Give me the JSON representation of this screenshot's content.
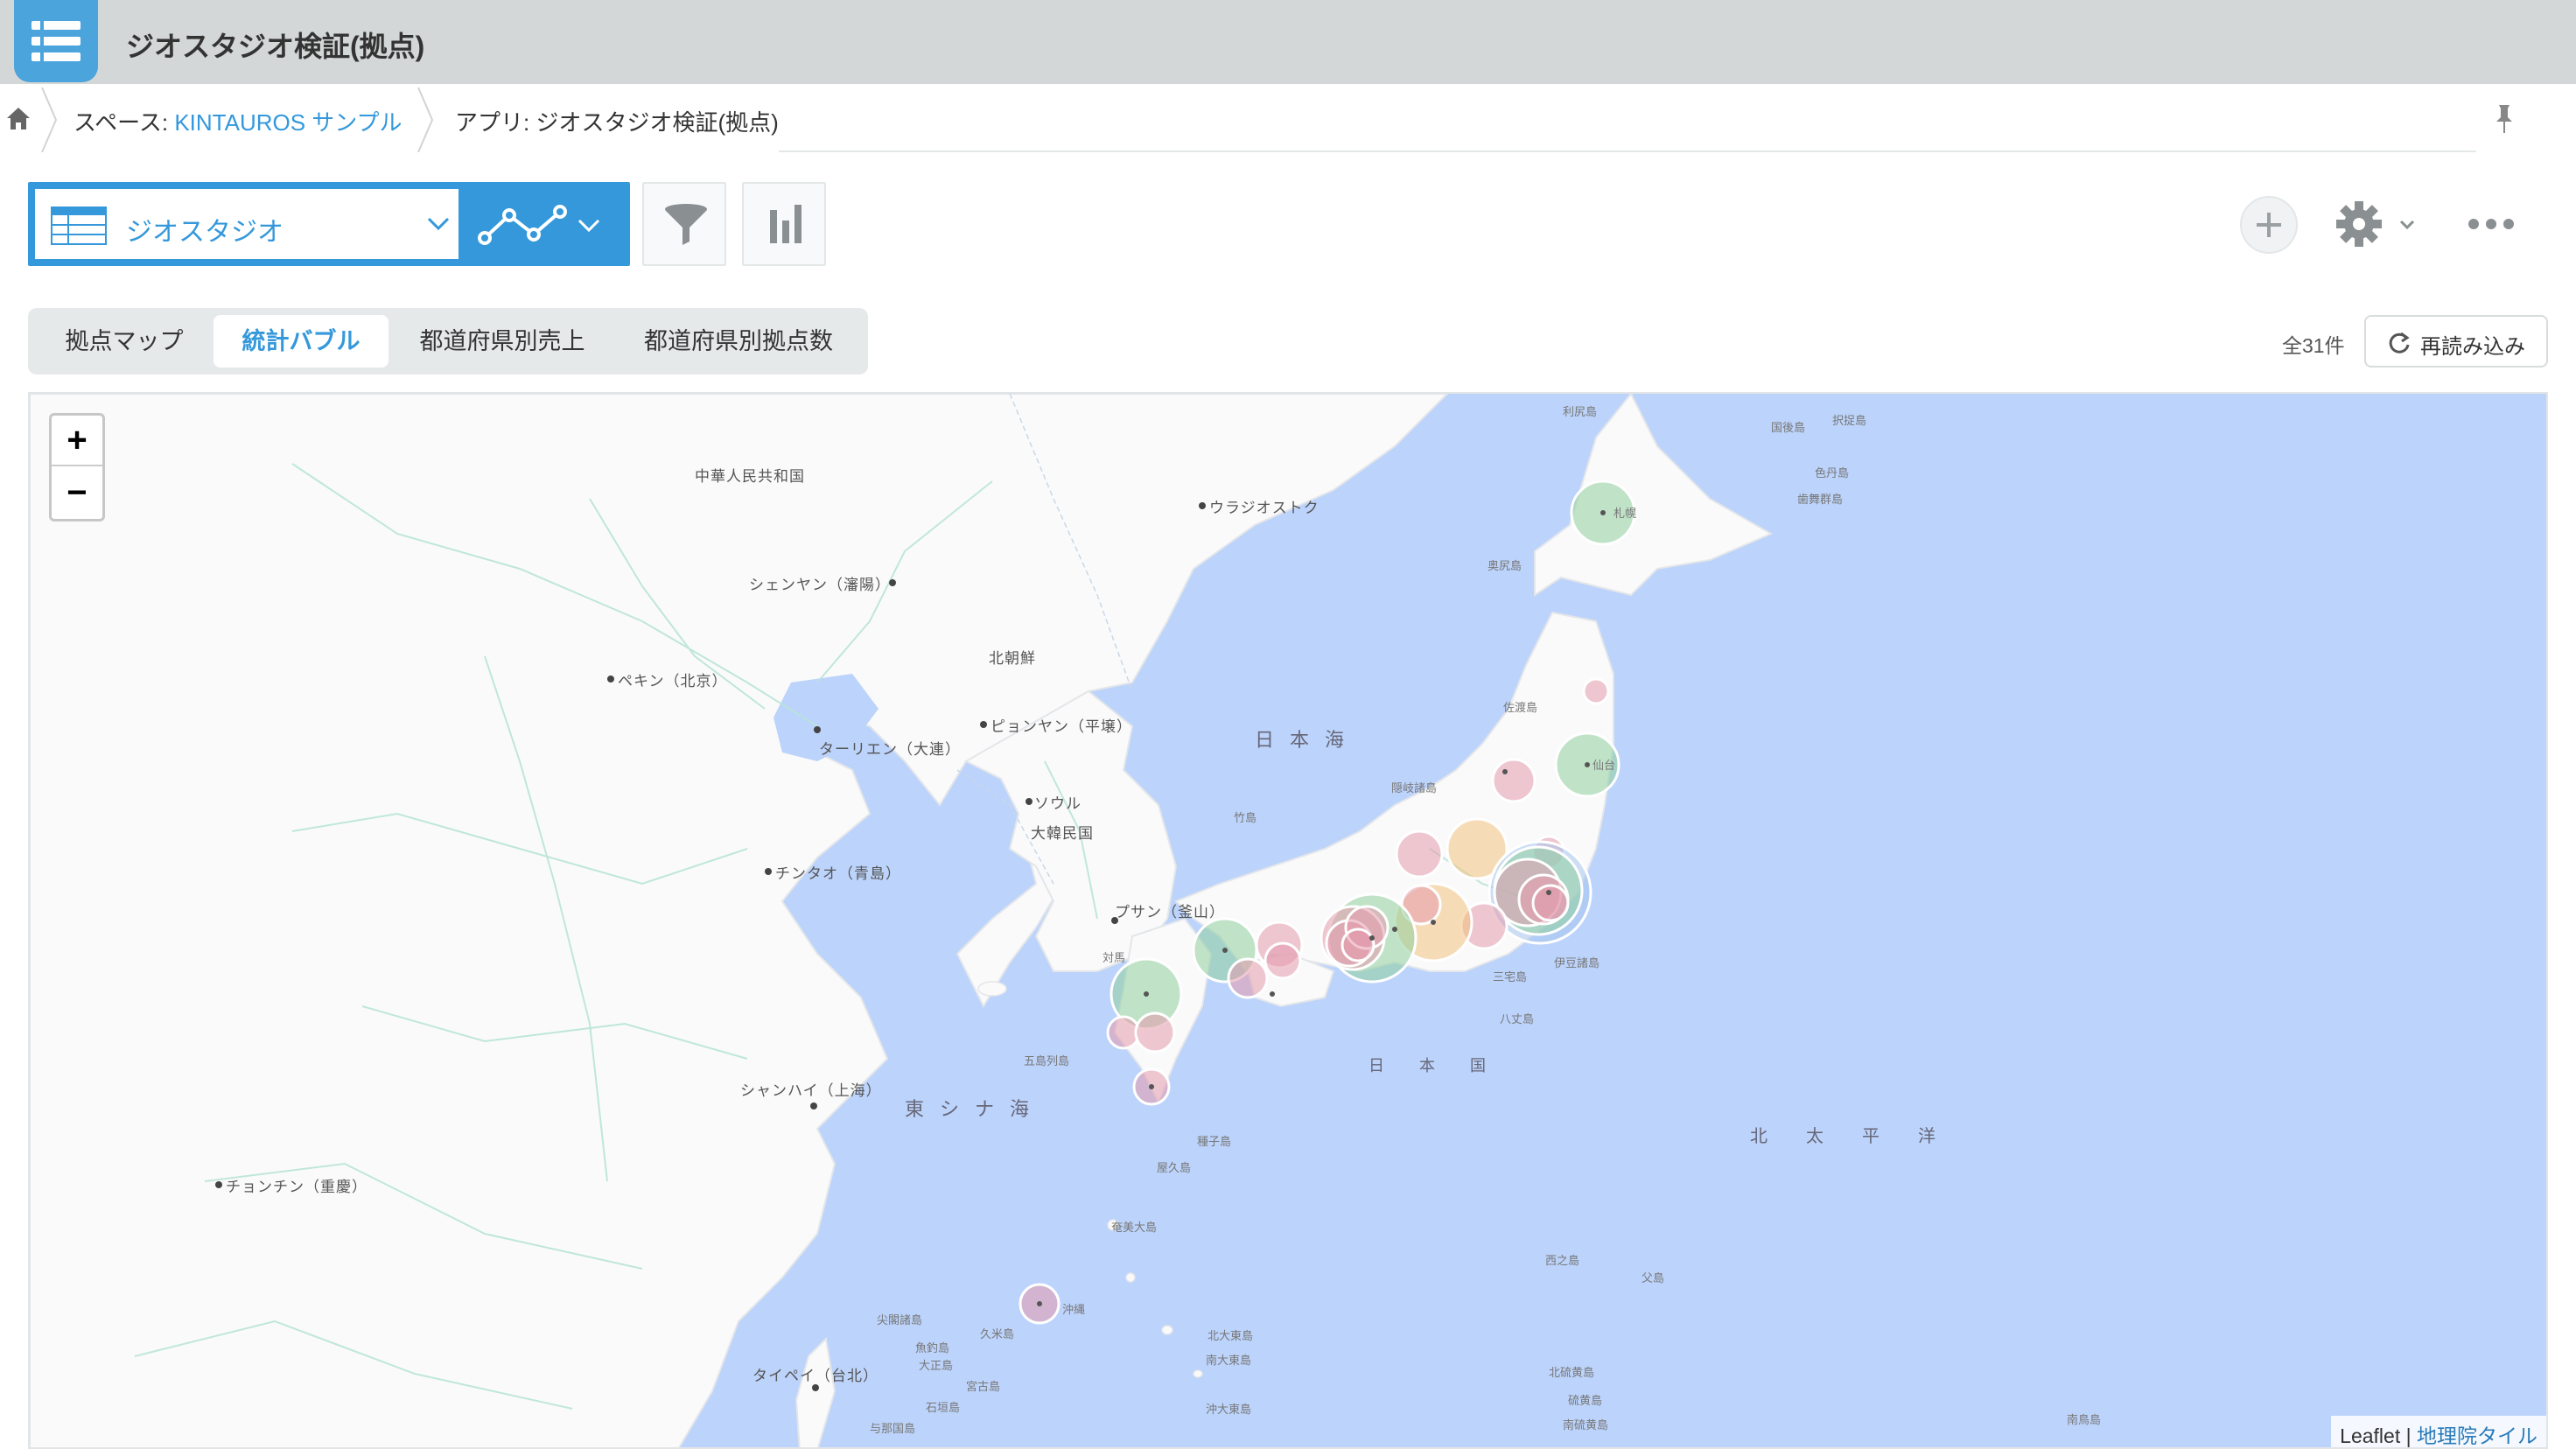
{
  "header": {
    "app_title": "ジオスタジオ検証(拠点)",
    "icon": "list-icon"
  },
  "breadcrumb": {
    "space_prefix": "スペース: ",
    "space_name": "KINTAUROS サンプル",
    "app_label": "アプリ: ジオスタジオ検証(拠点)"
  },
  "toolbar": {
    "view_name": "ジオスタジオ",
    "view_icon": "table-grid-icon",
    "graph_icon": "line-graph-icon",
    "filter_icon": "funnel-icon",
    "chart_icon": "bar-chart-icon",
    "add_icon": "plus-icon",
    "settings_icon": "gear-icon",
    "more_icon": "ellipsis-icon"
  },
  "tabs": [
    {
      "label": "拠点マップ",
      "active": false
    },
    {
      "label": "統計バブル",
      "active": true
    },
    {
      "label": "都道府県別売上",
      "active": false
    },
    {
      "label": "都道府県別拠点数",
      "active": false
    }
  ],
  "record_count": "全31件",
  "reload_label": "再読み込み",
  "map": {
    "zoom_in": "+",
    "zoom_out": "−",
    "attribution_leaflet": "Leaflet",
    "attribution_sep": " | ",
    "attribution_tiles": "地理院タイル",
    "labels": {
      "china": "中華人民共和国",
      "vladivostok": "ウラジオストク",
      "shenyang": "シェンヤン（瀋陽）",
      "beijing": "ペキン（北京）",
      "north_korea": "北朝鮮",
      "dalian": "ターリエン（大連）",
      "pyongyang": "ピョンヤン（平壌）",
      "sea_of_japan": "日本海",
      "seoul": "ソウル",
      "south_korea": "大韓民国",
      "qingdao": "チンタオ（青島）",
      "busan": "プサン（釜山）",
      "shanghai": "シャンハイ（上海）",
      "east_china_sea": "東シナ海",
      "chongqing": "チョンチン（重慶）",
      "japan": "日本国",
      "pacific": "北太平洋",
      "taipei": "タイペイ（台北）",
      "rishiri": "利尻島",
      "okushiri": "奥尻島",
      "sado": "佐渡島",
      "oki": "隠岐諸島",
      "takeshima": "竹島",
      "tsushima": "対馬",
      "goto": "五島列島",
      "tanegashima": "種子島",
      "yakushima": "屋久島",
      "amami": "奄美大島",
      "okinawa": "沖縄",
      "izu": "伊豆諸島",
      "hachijo": "八丈島",
      "miyake": "三宅島",
      "nishinoshima": "西之島",
      "chichijima": "父島",
      "iwojima": "硫黄島",
      "minamitori": "南鳥島",
      "kunashiri": "国後島",
      "etorofu": "択捉島",
      "shikotan": "色丹島",
      "habomai": "歯舞群島",
      "senkaku": "尖閣諸島",
      "ishigaki": "石垣島",
      "miyako": "宮古島",
      "yonaguni": "与那国島",
      "kitadaito": "北大東島",
      "minamidaito": "南大東島",
      "oki_daito": "沖大東島",
      "kita_iwo": "北硫黄島",
      "minami_iwo": "南硫黄島",
      "kume": "久米島",
      "yuboku": "魚釣島",
      "taisho": "大正島",
      "sendai_label": "仙台",
      "sapporo_label": "札幌"
    },
    "bubble_colors": {
      "green": "#8fcf9f",
      "pink": "#e39aad",
      "orange": "#f2c27e",
      "blue": "#a8c7ef"
    }
  }
}
